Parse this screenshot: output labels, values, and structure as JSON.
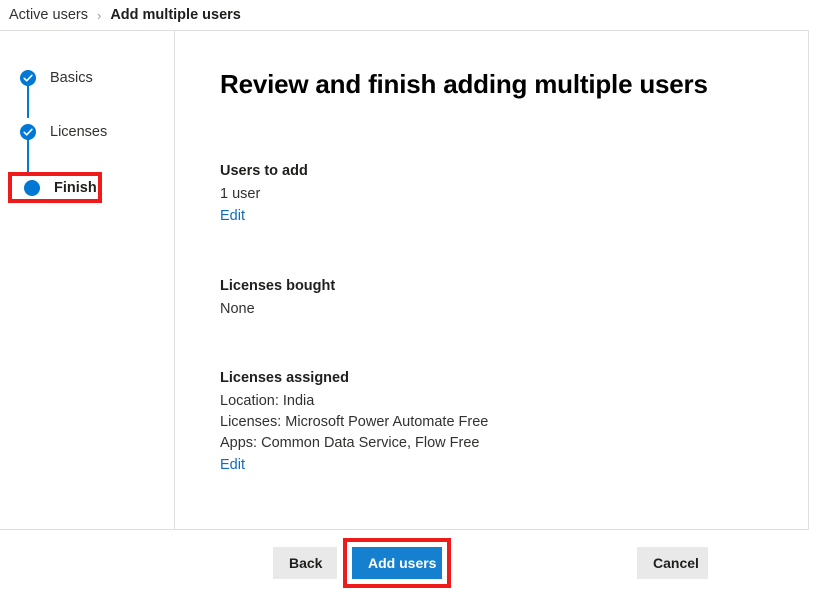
{
  "breadcrumb": {
    "parent": "Active users",
    "separator": "›",
    "current": "Add multiple users"
  },
  "steps": {
    "items": [
      {
        "label": "Basics",
        "state": "complete"
      },
      {
        "label": "Licenses",
        "state": "complete"
      },
      {
        "label": "Finish",
        "state": "current"
      }
    ]
  },
  "main": {
    "title": "Review and finish adding multiple users",
    "sections": [
      {
        "title": "Users to add",
        "lines": [
          "1 user"
        ],
        "edit_label": "Edit"
      },
      {
        "title": "Licenses bought",
        "lines": [
          "None"
        ],
        "edit_label": ""
      },
      {
        "title": "Licenses assigned",
        "lines": [
          "Location: India",
          "Licenses: Microsoft Power Automate Free",
          "Apps: Common Data Service, Flow Free"
        ],
        "edit_label": "Edit"
      }
    ]
  },
  "footer": {
    "back_label": "Back",
    "submit_label": "Add users",
    "cancel_label": "Cancel"
  },
  "colors": {
    "accent": "#0078d4",
    "primary_button": "#1680d0",
    "link": "#0f6cbd",
    "annotation": "#ef1a1a",
    "border": "#e1dfdd",
    "secondary_button": "#e9e9e9"
  }
}
